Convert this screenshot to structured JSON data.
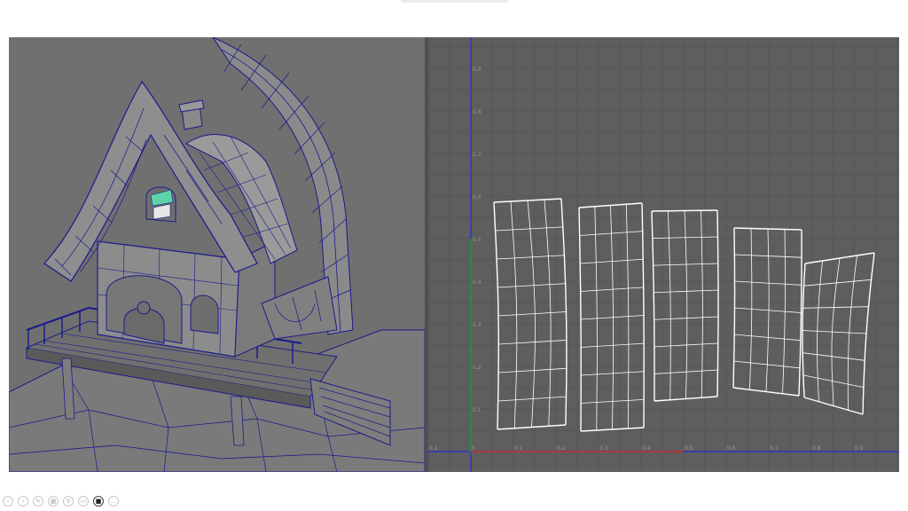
{
  "uv_editor": {
    "v_ticks": [
      "0.9",
      "0.8",
      "0.7",
      "0.6",
      "0.5",
      "0.4",
      "0.3",
      "0.2",
      "0.1"
    ],
    "u_ticks": [
      "0.1",
      "0",
      "0.1",
      "0.2",
      "0.3",
      "0.4",
      "0.5",
      "0.6",
      "0.7",
      "0.8",
      "0.9"
    ]
  },
  "presenter_controls": [
    {
      "name": "previous-slide-icon",
      "glyph": "‹"
    },
    {
      "name": "next-slide-icon",
      "glyph": "›"
    },
    {
      "name": "pen-icon",
      "glyph": "✎"
    },
    {
      "name": "see-all-slides-icon",
      "glyph": "▦"
    },
    {
      "name": "zoom-icon",
      "glyph": "⚲"
    },
    {
      "name": "subtitles-icon",
      "glyph": "▭"
    },
    {
      "name": "camera-icon",
      "glyph": "■"
    },
    {
      "name": "more-options-icon",
      "glyph": "…"
    }
  ],
  "colors": {
    "wire": "#1a1a8c",
    "uv_shell": "#ffffff",
    "axis_u": "#c8302a",
    "axis_v": "#2a9a2a",
    "axis_blue": "#2b2bd0"
  }
}
